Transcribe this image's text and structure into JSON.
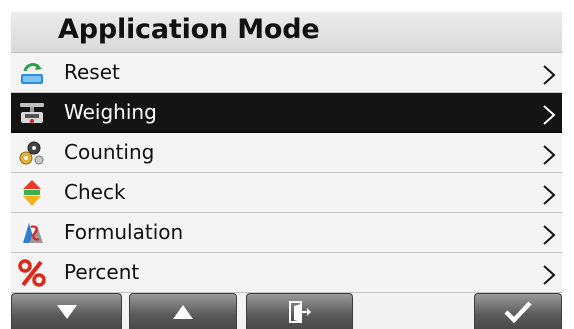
{
  "header": {
    "title": "Application Mode"
  },
  "menu": {
    "items": [
      {
        "label": "Reset",
        "icon": "reset-icon",
        "selected": false
      },
      {
        "label": "Weighing",
        "icon": "scale-icon",
        "selected": true
      },
      {
        "label": "Counting",
        "icon": "counting-icon",
        "selected": false
      },
      {
        "label": "Check",
        "icon": "check-weighing-icon",
        "selected": false
      },
      {
        "label": "Formulation",
        "icon": "formulation-icon",
        "selected": false
      },
      {
        "label": "Percent",
        "icon": "percent-icon",
        "selected": false
      }
    ]
  },
  "softkeys": {
    "down": "arrow-down-icon",
    "up": "arrow-up-icon",
    "exit": "exit-door-icon",
    "accept": "checkmark-icon"
  },
  "colors": {
    "selected_row": "#141414",
    "row_background": "#f4f4f4",
    "softkey": "#5a5a5a"
  }
}
